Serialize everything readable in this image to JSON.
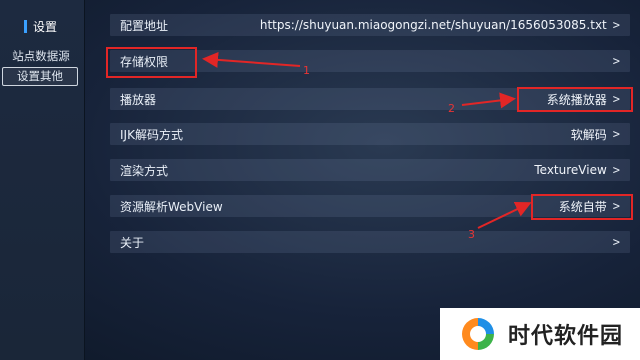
{
  "sidebar": {
    "title": "设置",
    "items": [
      {
        "label": "站点数据源",
        "selected": false
      },
      {
        "label": "设置其他",
        "selected": true
      }
    ]
  },
  "settings": [
    {
      "label": "配置地址",
      "value": "https://shuyuan.miaogongzi.net/shuyuan/1656053085.txt",
      "chevron": ">"
    },
    {
      "label": "存储权限",
      "value": "",
      "chevron": ">"
    },
    {
      "label": "播放器",
      "value": "系统播放器",
      "chevron": ">"
    },
    {
      "label": "IJK解码方式",
      "value": "软解码",
      "chevron": ">"
    },
    {
      "label": "渲染方式",
      "value": "TextureView",
      "chevron": ">"
    },
    {
      "label": "资源解析WebView",
      "value": "系统自带",
      "chevron": ">"
    },
    {
      "label": "关于",
      "value": "",
      "chevron": ">"
    }
  ],
  "annotations": {
    "n1": "1",
    "n2": "2",
    "n3": "3",
    "color": "#e22626"
  },
  "watermark": {
    "text": "时代软件园",
    "colors": [
      "#ff8a1e",
      "#3db34a",
      "#1f8fe6"
    ]
  }
}
